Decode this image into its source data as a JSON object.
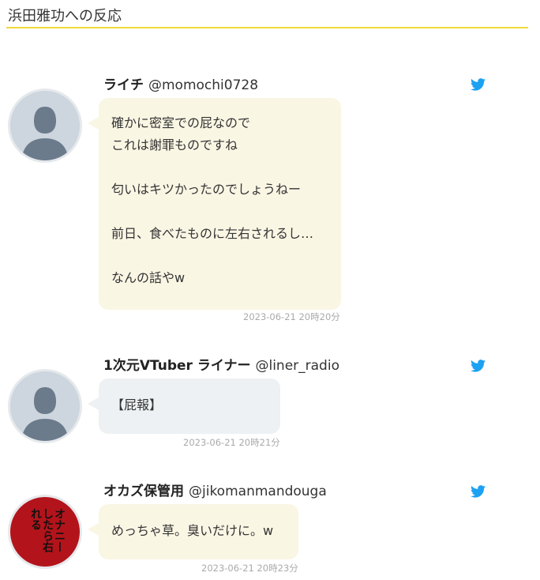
{
  "section": {
    "title": "浜田雅功への反応"
  },
  "tweets": [
    {
      "name": "ライチ",
      "handle": "@momochi0728",
      "lines": [
        "確かに密室での屁なので",
        "これは謝罪ものですね",
        "",
        "匂いはキツかったのでしょうねー",
        "",
        "前日、食べたものに左右されるし…",
        "",
        "なんの話やw"
      ],
      "timestamp": "2023-06-21 20時20分",
      "avatar": "default-avatar-icon",
      "bubble_color": "#faf6e4"
    },
    {
      "name": "1次元VTuber ライナー",
      "handle": "@liner_radio",
      "lines": [
        "【屁報】"
      ],
      "timestamp": "2023-06-21 20時21分",
      "avatar": "default-avatar-icon",
      "bubble_color": "#edf1f3"
    },
    {
      "name": "オカズ保管用",
      "handle": "@jikomanmandouga",
      "lines": [
        "めっちゃ草。臭いだけに。w"
      ],
      "timestamp": "2023-06-21 20時23分",
      "avatar": "red-avatar-image",
      "avatar_text": "オナニーしたら右れる",
      "bubble_color": "#faf6e4"
    }
  ],
  "colors": {
    "accent_rule": "#f1d93a",
    "twitter_blue": "#1da1f2"
  },
  "icons": {
    "twitter": "twitter-bird-icon"
  }
}
